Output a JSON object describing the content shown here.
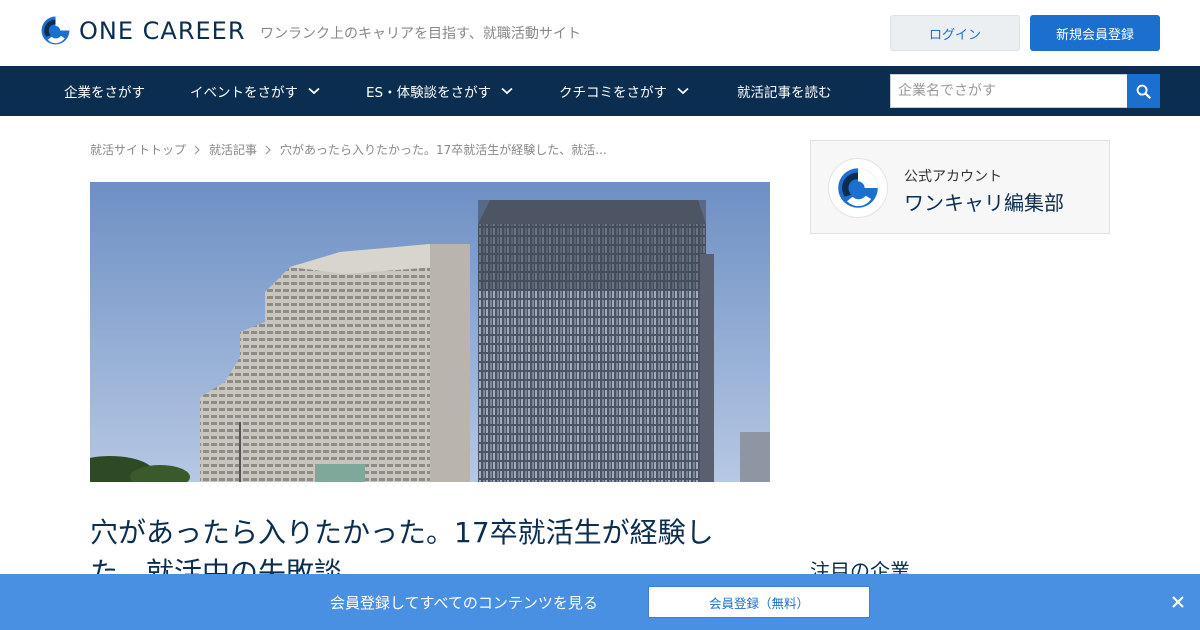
{
  "header": {
    "brand_name": "ONE CAREER",
    "tagline": "ワンランク上のキャリアを目指す、就職活動サイト",
    "login_label": "ログイン",
    "signup_label": "新規会員登録"
  },
  "nav": {
    "items": [
      {
        "label": "企業をさがす",
        "has_dropdown": false
      },
      {
        "label": "イベントをさがす",
        "has_dropdown": true
      },
      {
        "label": "ES・体験談をさがす",
        "has_dropdown": true
      },
      {
        "label": "クチコミをさがす",
        "has_dropdown": true
      },
      {
        "label": "就活記事を読む",
        "has_dropdown": false
      }
    ],
    "search_placeholder": "企業名でさがす",
    "search_icon": "search-icon"
  },
  "breadcrumb": [
    "就活サイトトップ",
    "就活記事",
    "穴があったら入りたかった。17卒就活生が経験した、就活..."
  ],
  "article": {
    "title": "穴があったら入りたかった。17卒就活生が経験した、就活中の失敗談"
  },
  "sidebar": {
    "account_label": "公式アカウント",
    "account_name": "ワンキャリ編集部",
    "featured_heading": "注目の企業"
  },
  "banner": {
    "text": "会員登録してすべてのコンテンツを見る",
    "button_label": "会員登録（無料）",
    "close_icon": "close-icon"
  },
  "colors": {
    "brand_navy": "#0b2d4f",
    "accent_blue": "#1a6fcf",
    "banner_blue": "#4a90e2"
  }
}
